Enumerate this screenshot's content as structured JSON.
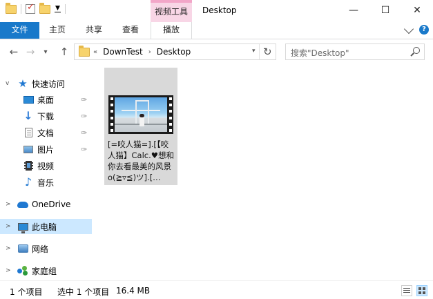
{
  "window": {
    "title": "Desktop",
    "context_tab": "视频工具",
    "minimize": "—",
    "maximize": "☐",
    "close": "✕"
  },
  "qat": {
    "dropdown": "▼"
  },
  "ribbon": {
    "tabs": [
      "文件",
      "主页",
      "共享",
      "查看",
      "播放"
    ]
  },
  "address": {
    "overflow": "«",
    "crumbs": [
      "DownTest",
      "Desktop"
    ],
    "separator": "›",
    "dropdown": "▾",
    "refresh": "↻",
    "back": "←",
    "forward": "→",
    "recent": "▾",
    "up": "↑"
  },
  "search": {
    "placeholder": "搜索\"Desktop\""
  },
  "sidebar": {
    "quick_access": "快速访问",
    "quick_items": [
      {
        "label": "桌面",
        "icon": "desktop-icon",
        "pinned": true
      },
      {
        "label": "下载",
        "icon": "download-icon",
        "pinned": true
      },
      {
        "label": "文档",
        "icon": "document-icon",
        "pinned": true
      },
      {
        "label": "图片",
        "icon": "picture-icon",
        "pinned": true
      },
      {
        "label": "视频",
        "icon": "video-icon",
        "pinned": false
      },
      {
        "label": "音乐",
        "icon": "music-icon",
        "pinned": false
      }
    ],
    "onedrive": "OneDrive",
    "this_pc": "此电脑",
    "network": "网络",
    "homegroup": "家庭组",
    "pin_glyph": "📌",
    "expand_glyph": ">",
    "expanded_glyph": "v"
  },
  "files": [
    {
      "name": "[=咬人猫=].[【咬人猫】Calc.♥想和你去看最美的风景o(≧▿≦)ツ].[…",
      "type": "video"
    }
  ],
  "status": {
    "count": "1 个项目",
    "selected": "选中 1 个项目",
    "size": "16.4 MB"
  },
  "colors": {
    "accent": "#1979ca",
    "selected_bg": "#cce8ff",
    "context_tab_bg": "#f8d6e6",
    "file_item_bg": "#d9d9d9"
  }
}
